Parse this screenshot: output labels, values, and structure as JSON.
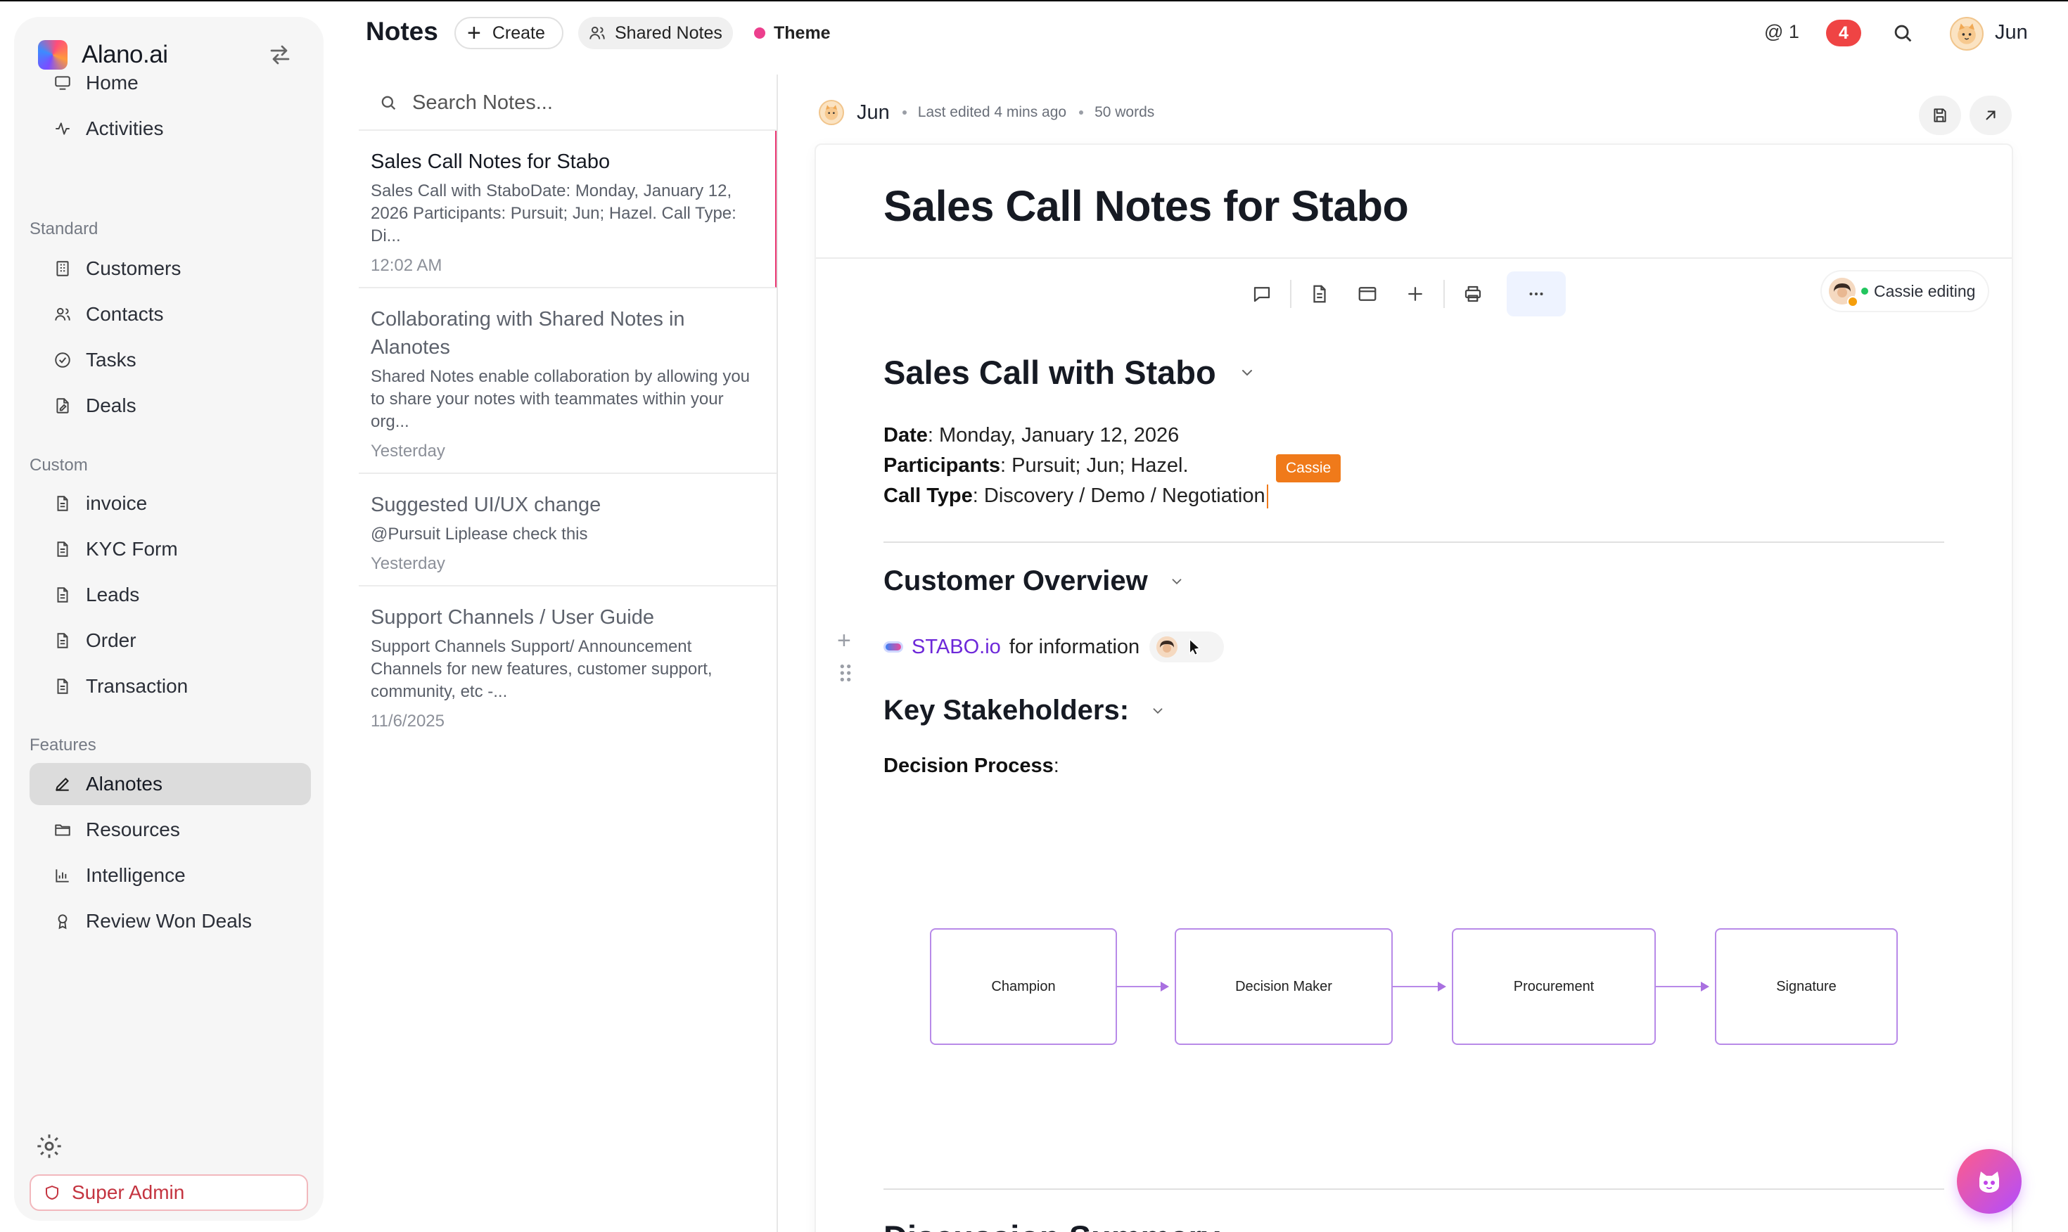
{
  "app": {
    "name": "Alano.ai"
  },
  "sidebar": {
    "main": [
      {
        "label": "Home",
        "icon": "monitor-icon"
      },
      {
        "label": "Activities",
        "icon": "activity-icon"
      }
    ],
    "standard_title": "Standard",
    "standard": [
      {
        "label": "Customers",
        "icon": "building-icon"
      },
      {
        "label": "Contacts",
        "icon": "users-icon"
      },
      {
        "label": "Tasks",
        "icon": "check-circle-icon"
      },
      {
        "label": "Deals",
        "icon": "document-edit-icon"
      }
    ],
    "custom_title": "Custom",
    "custom": [
      {
        "label": "invoice",
        "icon": "file-icon"
      },
      {
        "label": "KYC Form",
        "icon": "file-icon"
      },
      {
        "label": "Leads",
        "icon": "file-icon"
      },
      {
        "label": "Order",
        "icon": "file-icon"
      },
      {
        "label": "Transaction",
        "icon": "file-icon"
      }
    ],
    "features_title": "Features",
    "features": [
      {
        "label": "Alanotes",
        "icon": "pen-icon",
        "active": true
      },
      {
        "label": "Resources",
        "icon": "folder-icon"
      },
      {
        "label": "Intelligence",
        "icon": "bar-chart-icon"
      },
      {
        "label": "Review Won Deals",
        "icon": "award-icon"
      }
    ],
    "super_admin": "Super Admin"
  },
  "topbar": {
    "title": "Notes",
    "create": "Create",
    "shared_notes": "Shared Notes",
    "theme": "Theme",
    "mention_count": "1",
    "notification_count": "4",
    "user": "Jun"
  },
  "notes_list": {
    "search_placeholder": "Search Notes...",
    "notes": [
      {
        "title": "Sales Call Notes for Stabo",
        "body": "Sales Call with StaboDate: Monday, January 12, 2026 Participants: Pursuit; Jun; Hazel. Call Type: Di...",
        "time": "12:02 AM"
      },
      {
        "title": "Collaborating with Shared Notes in Alanotes",
        "body": "Shared Notes enable collaboration by allowing you to share your notes with teammates within your org...",
        "time": "Yesterday"
      },
      {
        "title": "Suggested UI/UX change",
        "body": "@Pursuit Liplease check this",
        "time": "Yesterday"
      },
      {
        "title": "Support Channels / User Guide",
        "body": "Support Channels Support/ Announcement Channels for new features, customer support, community, etc -...",
        "time": "11/6/2025"
      }
    ]
  },
  "editor": {
    "author": "Jun",
    "last_edited": "Last edited 4 mins ago",
    "word_count": "50 words",
    "editing_status": "Cassie editing",
    "doc_title": "Sales Call Notes for Stabo",
    "section1": "Sales Call with Stabo",
    "date_label": "Date",
    "date_value": ": Monday, January 12, 2026",
    "participants_label": "Participants",
    "participants_value": ": Pursuit; Jun; Hazel.",
    "calltype_label": "Call Type",
    "calltype_value": ": Discovery / Demo / Negotiation",
    "cursor_tag": "Cassie",
    "section2": "Customer Overview",
    "stabo_link": "STABO.io",
    "stabo_text": "for information",
    "section3": "Key Stakeholders:",
    "decision_label": "Decision Process",
    "decision_colon": ":",
    "flow": [
      "Champion",
      "Decision Maker",
      "Procurement",
      "Signature"
    ],
    "next_section": "Discussion Summary"
  },
  "colors": {
    "accent_pink": "#e8336f",
    "badge_red": "#ef4444",
    "cursor_orange": "#f07a1a",
    "flow_purple": "#b88ae8",
    "link_purple": "#6d28d9"
  }
}
